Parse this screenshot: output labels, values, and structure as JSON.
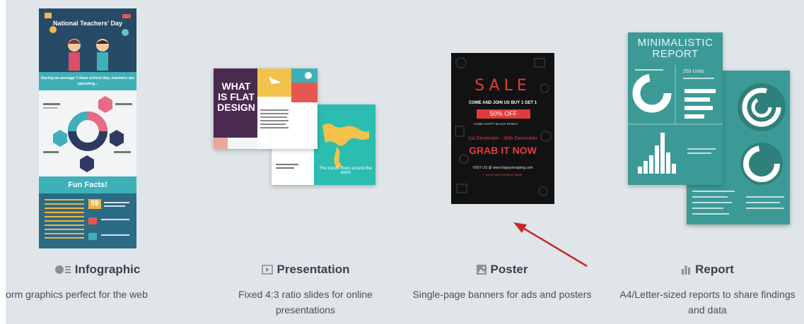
{
  "cards": [
    {
      "title": "Infographic",
      "icon": "infographic-icon",
      "description": "ng-form graphics perfect for the web",
      "thumbnail": {
        "header": "National Teachers' Day",
        "band": "During an average 7-hour school day, teachers are spending...",
        "section": "Fun Facts!",
        "stat": "59"
      }
    },
    {
      "title": "Presentation",
      "icon": "presentation-icon",
      "description": "Fixed 4:3 ratio slides for online presentations",
      "thumbnail": {
        "slide1_title": "WHAT IS FLAT DESIGN",
        "slide2_caption": "The trends flows around the world"
      }
    },
    {
      "title": "Poster",
      "icon": "image-icon",
      "description": "Single-page banners for ads and posters",
      "thumbnail": {
        "headline": "SALE",
        "line1": "COME AND JOIN US BUY 1 GET 1",
        "badge": "50% OFF",
        "line2": "CODE  HAPPY BLACK FRIDAY",
        "dates": "1st December - 30th December",
        "cta": "GRAB IT NOW",
        "visit": "VISIT US @ www.happyshopping.com",
        "terms": "* terms and condition apply"
      }
    },
    {
      "title": "Report",
      "icon": "bar-chart-icon",
      "description": "A4/Letter-sized reports to share findings and data",
      "thumbnail": {
        "title": "MINIMALISTIC REPORT",
        "units": "255 Units"
      }
    }
  ],
  "colors": {
    "background": "#dfe5e8",
    "title": "#3a4150",
    "accent_red": "#c62828",
    "teal": "#3b9a96"
  }
}
